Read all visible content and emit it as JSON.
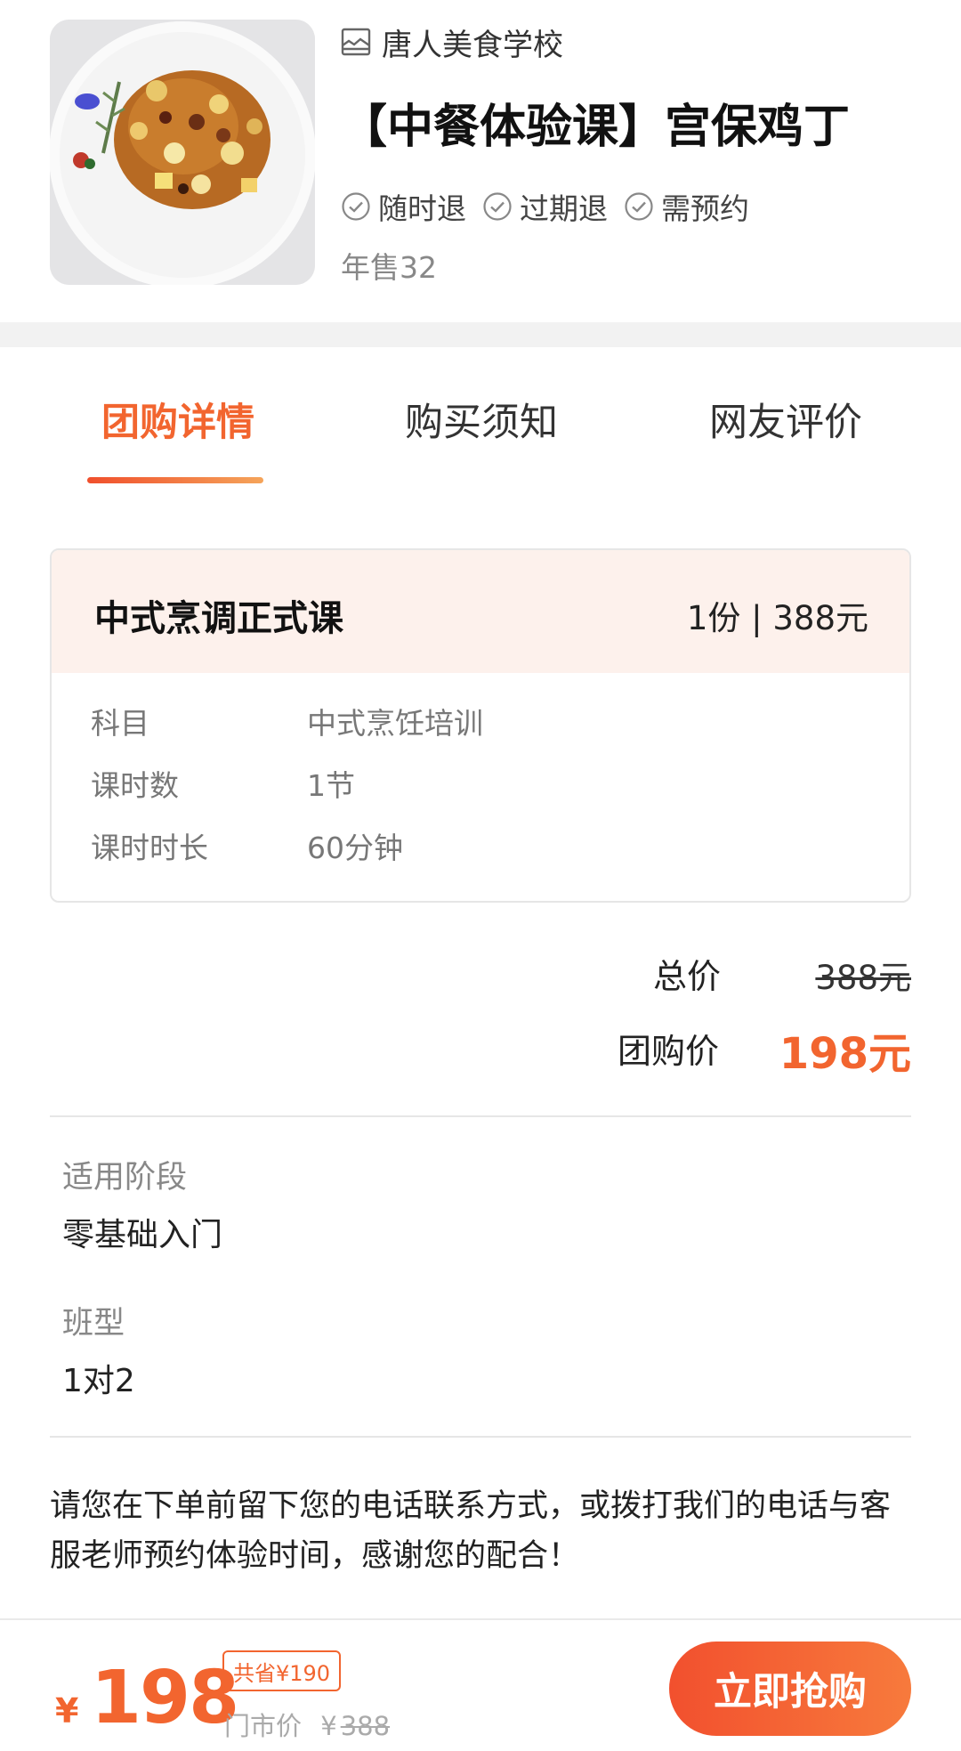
{
  "product": {
    "shop_name": "唐人美食学校",
    "title": "【中餐体验课】宫保鸡丁",
    "tags": [
      {
        "label": "随时退",
        "icon": "check-circle-icon"
      },
      {
        "label": "过期退",
        "icon": "check-circle-icon"
      },
      {
        "label": "需预约",
        "icon": "check-circle-icon"
      }
    ],
    "sales": "年售32"
  },
  "tabs": [
    {
      "label": "团购详情",
      "active": true
    },
    {
      "label": "购买须知",
      "active": false
    },
    {
      "label": "网友评价",
      "active": false
    }
  ],
  "package": {
    "name": "中式烹调正式课",
    "qty_price": "1份 | 388元",
    "rows": [
      {
        "label": "科目",
        "value": "中式烹饪培训"
      },
      {
        "label": "课时数",
        "value": "1节"
      },
      {
        "label": "课时时长",
        "value": "60分钟"
      }
    ]
  },
  "summary": {
    "total_label": "总价",
    "total_value": "388元",
    "group_label": "团购价",
    "group_value": "198元"
  },
  "details": {
    "stage_label": "适用阶段",
    "stage_value": "零基础入门",
    "class_label": "班型",
    "class_value": "1对2"
  },
  "note": "请您在下单前留下您的电话联系方式，或拨打我们的电话与客服老师预约体验时间，感谢您的配合！",
  "bottom_bar": {
    "currency": "¥",
    "price": "198",
    "save_badge": "共省¥190",
    "market_label": "门市价",
    "market_currency": "¥",
    "market_price": "388",
    "buy_button": "立即抢购"
  },
  "colors": {
    "accent": "#f2652f",
    "card_header_bg": "#fdf1ec",
    "separator_bg": "#f2f2f2"
  }
}
